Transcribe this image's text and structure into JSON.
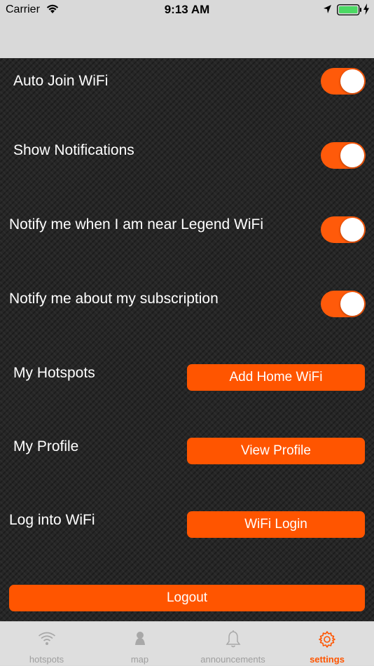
{
  "status_bar": {
    "carrier": "Carrier",
    "time": "9:13 AM"
  },
  "settings": {
    "auto_join_label": "Auto Join WiFi",
    "show_notifications_label": "Show Notifications",
    "notify_near_label": "Notify me when I am near Legend WiFi",
    "notify_subscription_label": "Notify me about my subscription",
    "toggles": {
      "auto_join": true,
      "show_notifications": true,
      "notify_near": true,
      "notify_subscription": true
    },
    "my_hotspots_label": "My Hotspots",
    "add_home_wifi_button": "Add Home WiFi",
    "my_profile_label": "My Profile",
    "view_profile_button": "View Profile",
    "log_into_wifi_label": "Log into WiFi",
    "wifi_login_button": "WiFi Login",
    "logout_button": "Logout"
  },
  "tabs": [
    {
      "label": "hotspots",
      "icon": "wifi-icon",
      "active": false
    },
    {
      "label": "map",
      "icon": "map-pin-icon",
      "active": false
    },
    {
      "label": "announcements",
      "icon": "bell-icon",
      "active": false
    },
    {
      "label": "settings",
      "icon": "gear-icon",
      "active": true
    }
  ],
  "colors": {
    "accent": "#ff5500",
    "background": "#262626",
    "tab_bar": "#dedede"
  }
}
